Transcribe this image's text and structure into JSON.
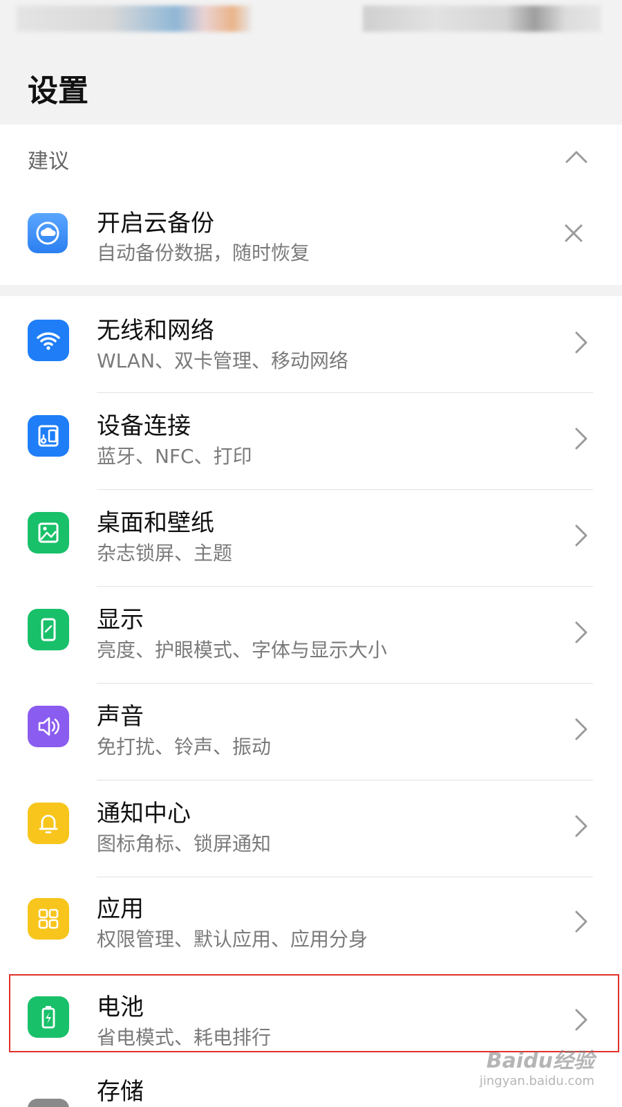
{
  "header": {
    "title": "设置"
  },
  "suggestions": {
    "label": "建议",
    "item": {
      "title": "开启云备份",
      "subtitle": "自动备份数据，随时恢复",
      "icon": "cloud-backup-icon"
    }
  },
  "settings": [
    {
      "title": "无线和网络",
      "subtitle": "WLAN、双卡管理、移动网络",
      "icon": "wifi-icon",
      "color": "#1f7ef7"
    },
    {
      "title": "设备连接",
      "subtitle": "蓝牙、NFC、打印",
      "icon": "device-connect-icon",
      "color": "#1f7ef7"
    },
    {
      "title": "桌面和壁纸",
      "subtitle": "杂志锁屏、主题",
      "icon": "wallpaper-icon",
      "color": "#19c06a"
    },
    {
      "title": "显示",
      "subtitle": "亮度、护眼模式、字体与显示大小",
      "icon": "display-icon",
      "color": "#19c06a"
    },
    {
      "title": "声音",
      "subtitle": "免打扰、铃声、振动",
      "icon": "speaker-icon",
      "color": "#8b5cf0"
    },
    {
      "title": "通知中心",
      "subtitle": "图标角标、锁屏通知",
      "icon": "bell-icon",
      "color": "#f7c51c"
    },
    {
      "title": "应用",
      "subtitle": "权限管理、默认应用、应用分身",
      "icon": "apps-grid-icon",
      "color": "#f7c51c"
    },
    {
      "title": "电池",
      "subtitle": "省电模式、耗电排行",
      "icon": "battery-icon",
      "color": "#19c06a"
    },
    {
      "title": "存储",
      "subtitle": "",
      "icon": "storage-icon",
      "color": "#8a8a8a"
    }
  ],
  "watermark": {
    "main": "Baidu经验",
    "sub": "jingyan.baidu.com"
  }
}
